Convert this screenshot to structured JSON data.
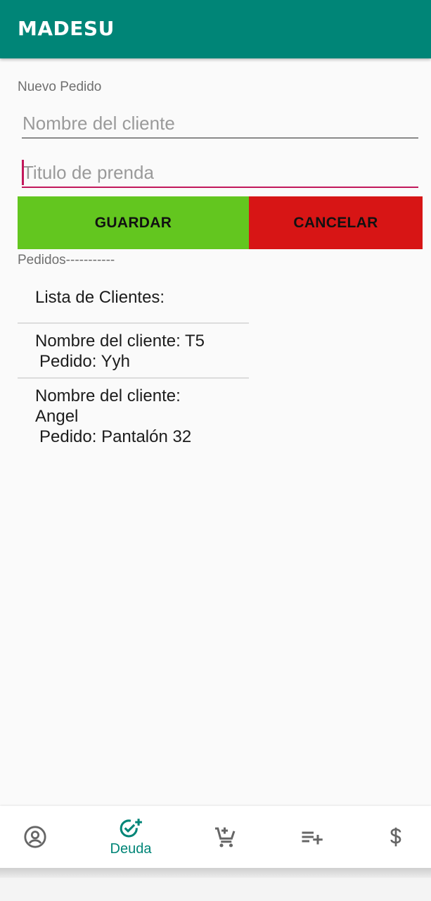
{
  "app": {
    "title": "MADESU"
  },
  "form": {
    "section_label": "Nuevo Pedido",
    "client_name_placeholder": "Nombre del cliente",
    "client_name_value": "",
    "garment_title_placeholder": "Titulo de prenda",
    "garment_title_value": "",
    "save_label": "GUARDAR",
    "cancel_label": "CANCELAR"
  },
  "orders": {
    "section_label": "Pedidos-----------",
    "list_header": "Lista de Clientes:",
    "items": [
      {
        "client": "Nombre del cliente: T5",
        "order": "Pedido: Yyh"
      },
      {
        "client": "Nombre del cliente: Angel",
        "order": "Pedido: Pantalón 32"
      }
    ]
  },
  "bottom_nav": {
    "items": [
      {
        "icon": "account-circle-icon",
        "label": ""
      },
      {
        "icon": "check-circle-plus-icon",
        "label": "Deuda",
        "active": true
      },
      {
        "icon": "cart-plus-icon",
        "label": ""
      },
      {
        "icon": "playlist-add-icon",
        "label": ""
      },
      {
        "icon": "dollar-icon",
        "label": ""
      }
    ]
  },
  "colors": {
    "primary": "#008577",
    "accent": "#c2185b",
    "save": "#63c61f",
    "cancel": "#d71515"
  }
}
